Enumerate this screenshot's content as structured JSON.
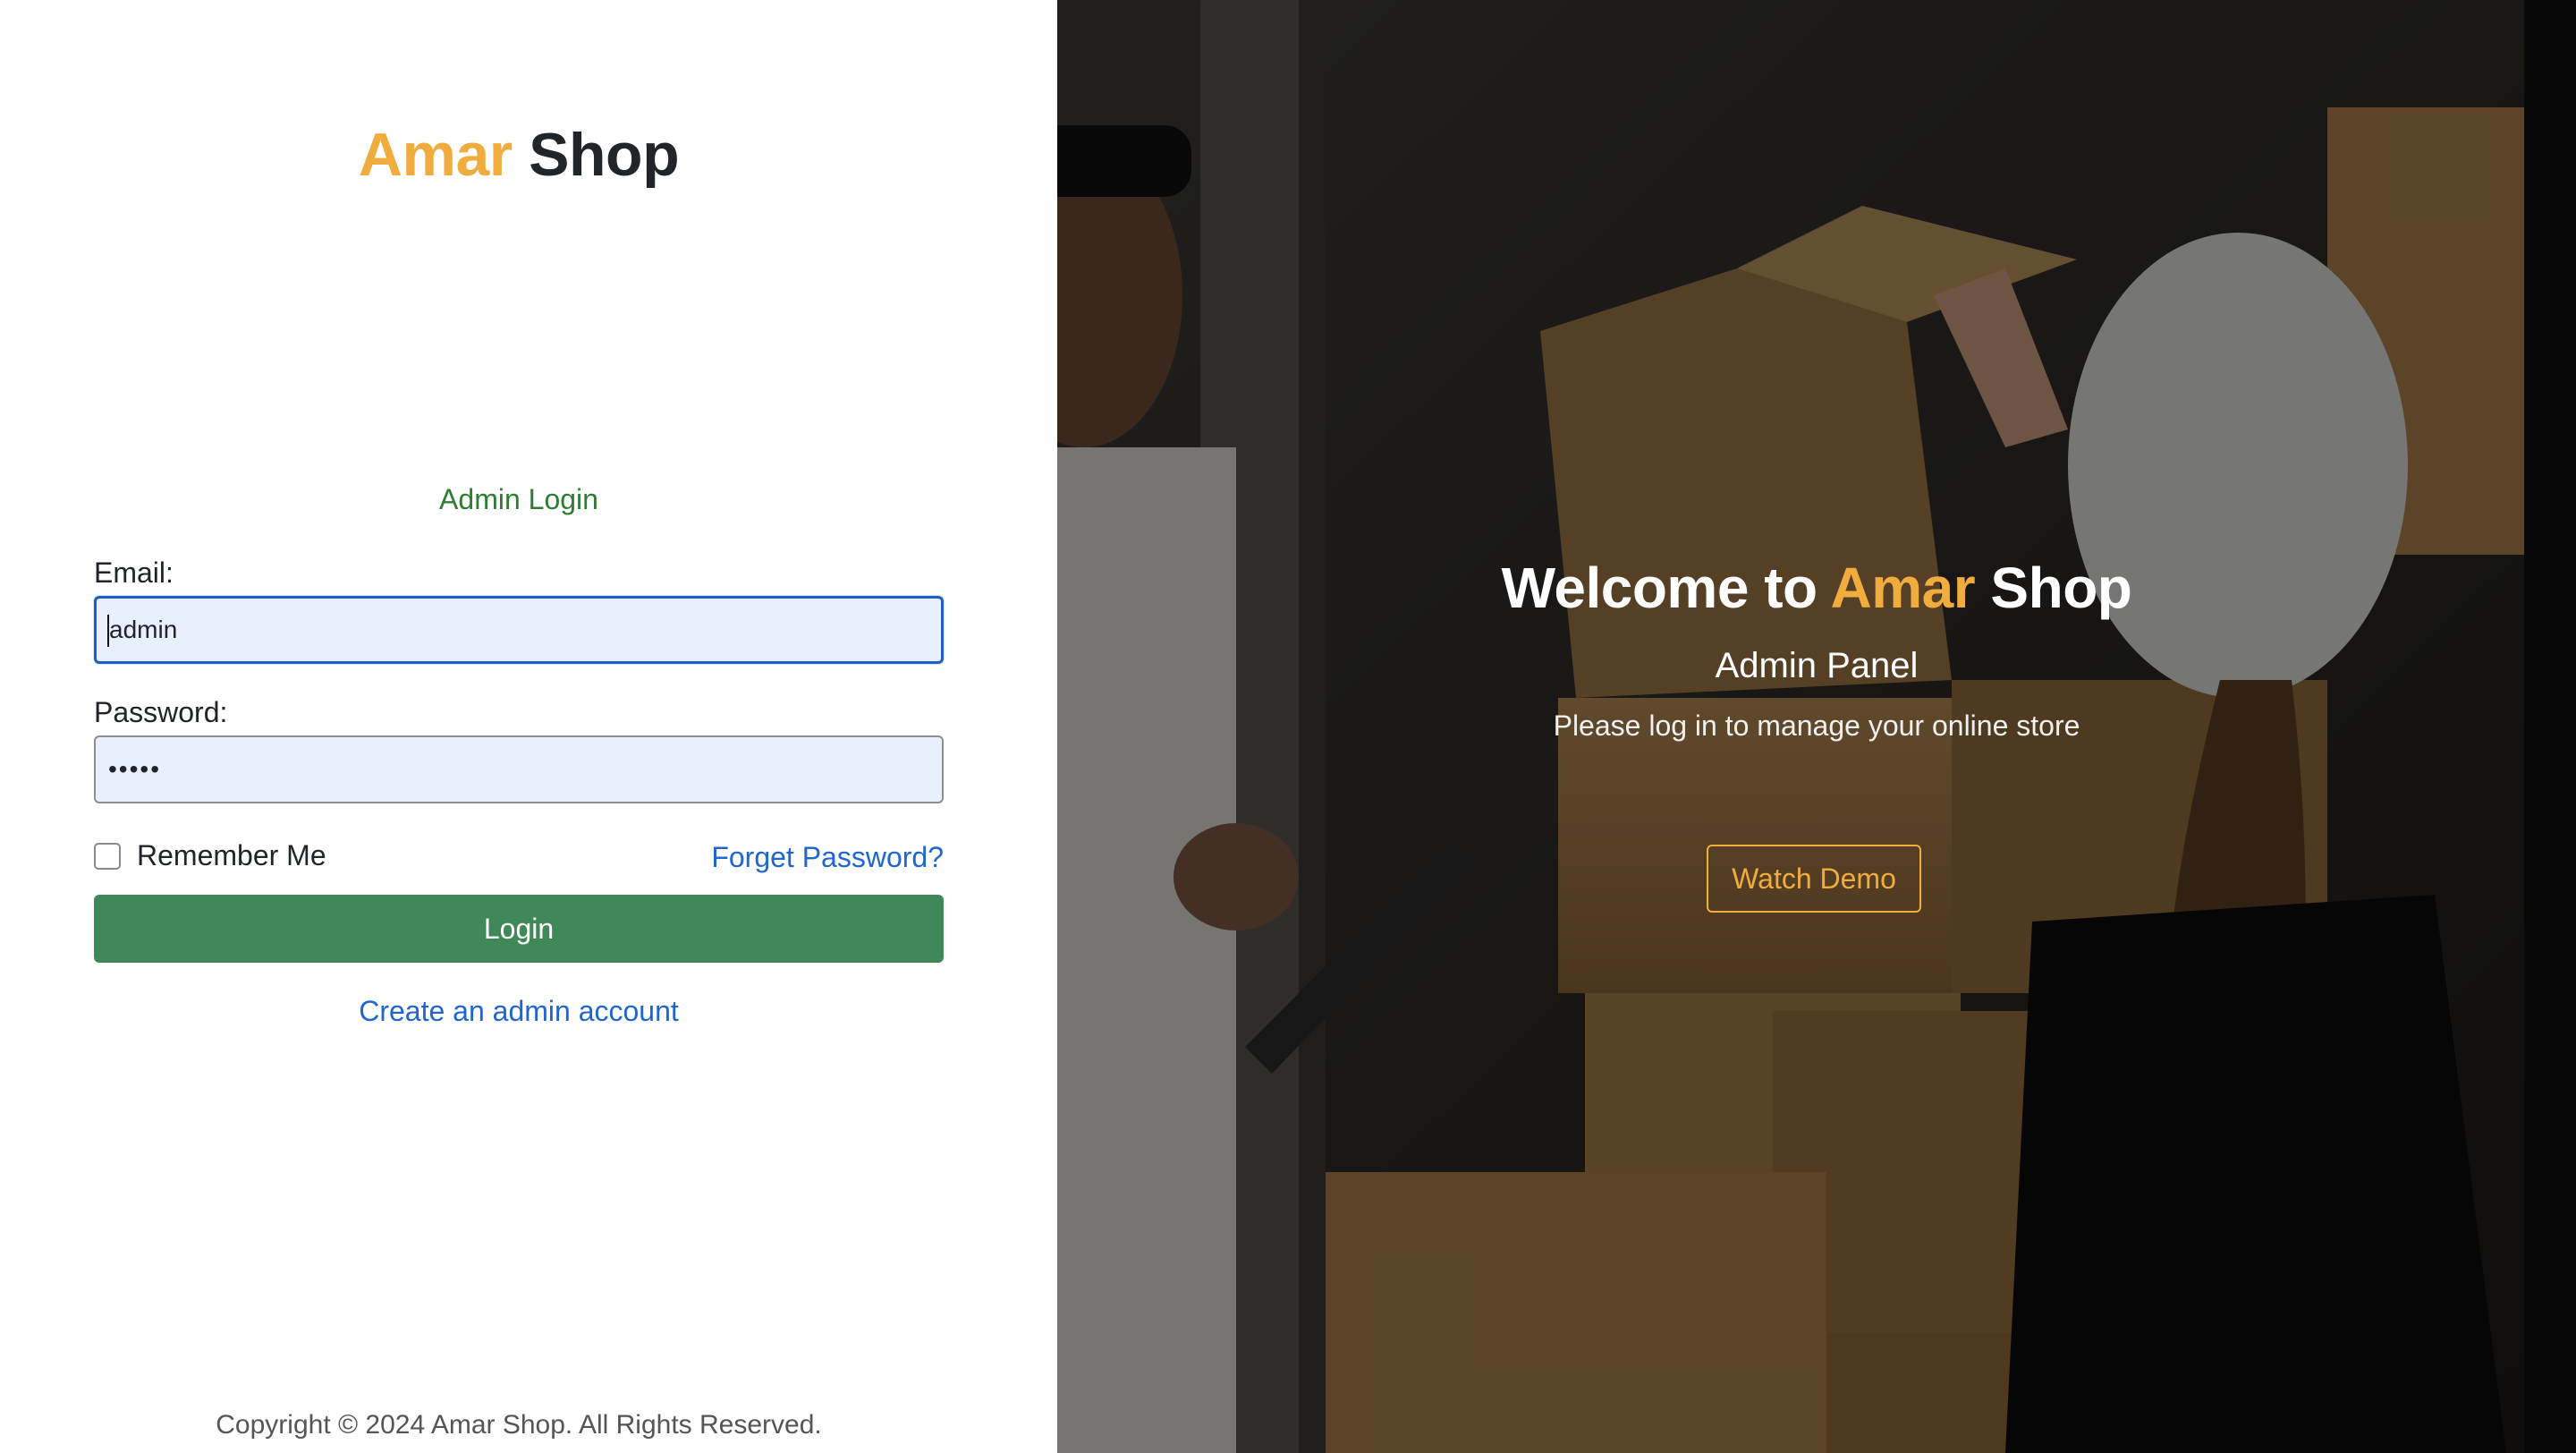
{
  "brand": {
    "accent": "Amar",
    "rest": "Shop"
  },
  "login": {
    "title": "Admin Login",
    "email_label": "Email:",
    "email_value": "admin",
    "password_label": "Password:",
    "password_value": "•••••",
    "remember_label": "Remember Me",
    "forgot_label": "Forget Password?",
    "login_label": "Login",
    "create_label": "Create an admin account"
  },
  "footer": {
    "copyright": "Copyright © 2024 Amar Shop. All Rights Reserved."
  },
  "hero": {
    "title_prefix": "Welcome to",
    "title_accent": "Amar",
    "title_rest": "Shop",
    "subtitle": "Admin Panel",
    "description": "Please log in to manage your online store",
    "demo_label": "Watch Demo"
  },
  "colors": {
    "accent": "#f0ad3e",
    "primary_button": "#3f8958",
    "link": "#1f66d1",
    "title_green": "#2e7d32"
  }
}
